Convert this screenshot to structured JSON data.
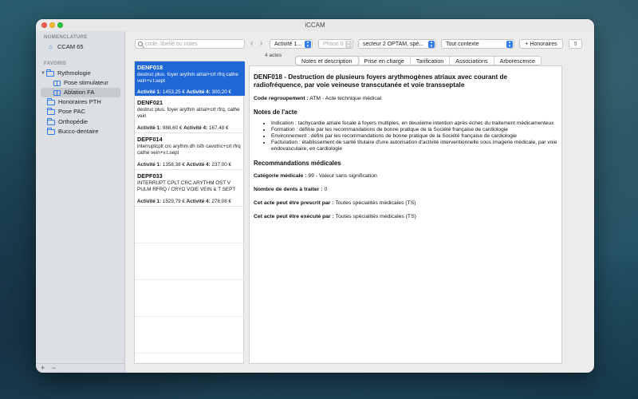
{
  "window": {
    "title": "iCCAM"
  },
  "sidebar": {
    "section_nomenclature": "NOMENCLATURE",
    "nomenclature_item": "CCAM 65",
    "section_favoris": "FAVORIS",
    "items": [
      {
        "label": "Rythmologie"
      },
      {
        "label": "Pose stimulateur"
      },
      {
        "label": "Ablation FA"
      },
      {
        "label": "Honoraires PTH"
      },
      {
        "label": "Pose PAC"
      },
      {
        "label": "Orthopédie"
      },
      {
        "label": "Bucco-dentaire"
      }
    ],
    "footer_add": "+",
    "footer_remove": "−"
  },
  "toolbar": {
    "search_placeholder": "code, libellé ou notes",
    "count": "4 actes",
    "activite": "Activité 1...",
    "phase": "Phase 0",
    "secteur": "secteur 2 OPTAM, spé...",
    "contexte": "Tout contexte",
    "honoraires": "+ Honoraires"
  },
  "list": [
    {
      "code": "DENF018",
      "desc": "destruc plus. foyer arythm atrial+crt rfrq cathe vein+v.t.sept",
      "a1_label": "Activité 1:",
      "a1": "1453,25 €",
      "a4_label": "Activité 4:",
      "a4": "300,20 €"
    },
    {
      "code": "DENF021",
      "desc": "destruc plus. foyer arythm atrial+crt rfrq, cathe vein",
      "a1_label": "Activité 1:",
      "a1": "988,60 €",
      "a4_label": "Activité 4:",
      "a4": "167,48 €"
    },
    {
      "code": "DEPF014",
      "desc": "interruptcplt crc arythm dh isth cavotric+crt rfrq cathe vein+v.t.sept",
      "a1_label": "Activité 1:",
      "a1": "1358,38 €",
      "a4_label": "Activité 4:",
      "a4": "237,00 €"
    },
    {
      "code": "DEPF033",
      "desc": "INTERRUPT CPLT CRC ARYTHM OST V PULM RFRQ / CRYO VOIE VEIN & T SEPT",
      "a1_label": "Activité 1:",
      "a1": "1529,79 €",
      "a4_label": "Activité 4:",
      "a4": "278,08 €"
    }
  ],
  "tabs": [
    "Notes et description",
    "Prise en charge",
    "Tarification",
    "Associations",
    "Arborescence"
  ],
  "detail": {
    "title": "DENF018 - Destruction de plusieurs foyers arythmogènes atriaux avec courant de radiofréquence, par voie veineuse transcutanée et voie transseptale",
    "regroupement_label": "Code regroupement :",
    "regroupement_value": "ATM - Acte technique médical",
    "notes_heading": "Notes de l'acte",
    "notes": [
      "Indication : tachycardie atriale focale à foyers multiples, en deuxième intention après échec du traitement médicamenteux",
      "Formation : définie par les recommandations de bonne pratique de la Société française de cardiologie",
      "Environnement : défini par les recommandations de bonne pratique de la Société française de cardiologie",
      "Facturation : établissement de santé titulaire d'une autorisation d'activité interventionnelle sous imagerie médicale, par voie endovasculaire, en cardiologie"
    ],
    "reco_heading": "Recommandations médicales",
    "categorie_label": "Catégorie médicale :",
    "categorie_value": "99 - Valeur sans signification",
    "dents_label": "Nombre de dents à traiter :",
    "dents_value": "0",
    "prescrit_label": "Cet acte peut être prescrit par :",
    "prescrit_value": "Toutes spécialités médicales (TS)",
    "execute_label": "Cet acte peut être exécuté par :",
    "execute_value": "Toutes spécialités médicales (TS)"
  }
}
